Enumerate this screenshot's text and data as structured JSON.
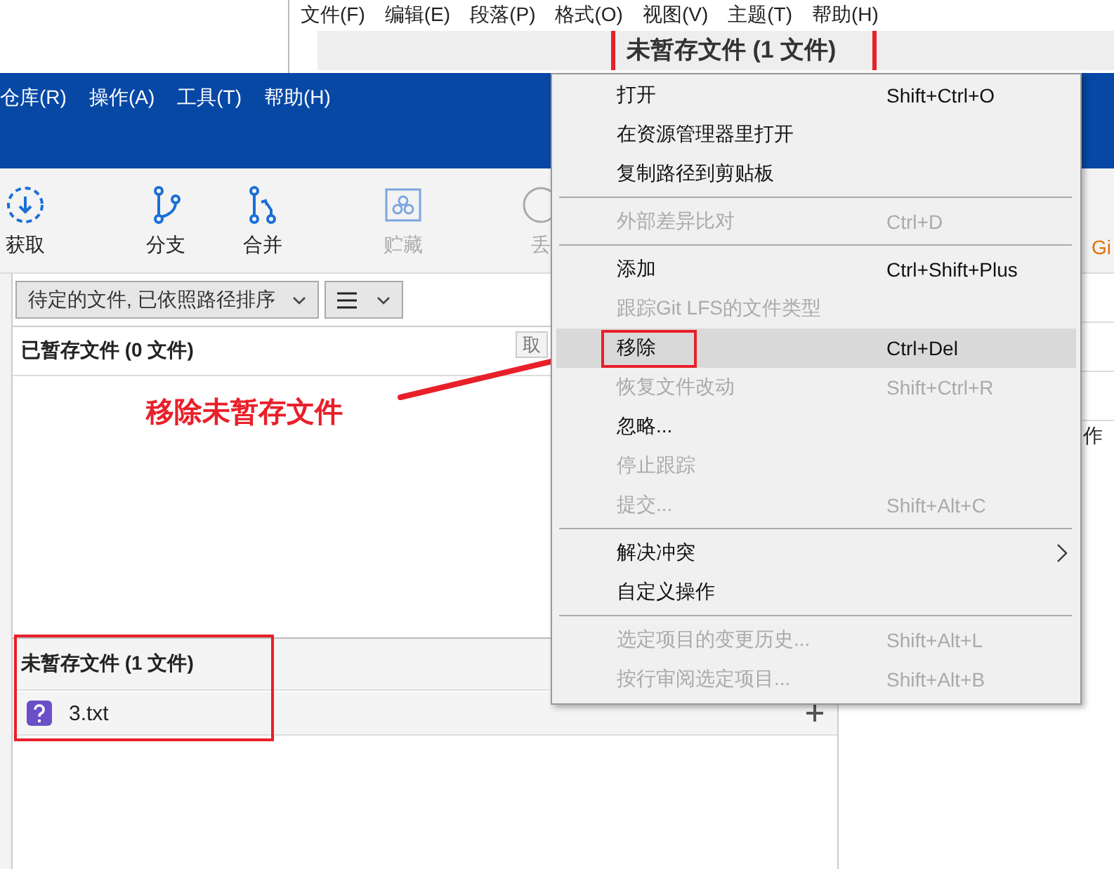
{
  "back_window": {
    "menu": [
      "文件(F)",
      "编辑(E)",
      "段落(P)",
      "格式(O)",
      "视图(V)",
      "主题(T)",
      "帮助(H)"
    ],
    "banner_title": "未暂存文件 (1 文件)"
  },
  "main_window": {
    "menu": [
      "仓库(R)",
      "操作(A)",
      "工具(T)",
      "帮助(H)"
    ],
    "toolbar": [
      {
        "label": "获取",
        "kind": "fetch",
        "disabled": false
      },
      {
        "label": "分支",
        "kind": "branch",
        "disabled": false
      },
      {
        "label": "合并",
        "kind": "merge",
        "disabled": false
      },
      {
        "label": "贮藏",
        "kind": "stash",
        "disabled": true
      },
      {
        "label": "丢",
        "kind": "discard",
        "disabled": true
      }
    ],
    "filter_dropdown": "待定的文件, 已依照路径排序",
    "staged": {
      "title": "已暂存文件 (0 文件)",
      "button": "取"
    },
    "unstaged": {
      "title": "未暂存文件 (1 文件)",
      "files": [
        {
          "name": "3.txt",
          "kind": "untracked"
        }
      ]
    },
    "right_pane": {
      "toolbar_label": "Gi",
      "row_text": "作"
    }
  },
  "context_menu": [
    {
      "kind": "item",
      "label": "打开",
      "shortcut": "Shift+Ctrl+O",
      "disabled": false,
      "selected": false,
      "submenu": false
    },
    {
      "kind": "item",
      "label": "在资源管理器里打开",
      "disabled": false,
      "selected": false,
      "submenu": false
    },
    {
      "kind": "item",
      "label": "复制路径到剪贴板",
      "disabled": false,
      "selected": false,
      "submenu": false
    },
    {
      "kind": "separator"
    },
    {
      "kind": "item",
      "label": "外部差异比对",
      "shortcut": "Ctrl+D",
      "disabled": true,
      "selected": false,
      "submenu": false
    },
    {
      "kind": "separator"
    },
    {
      "kind": "item",
      "label": "添加",
      "shortcut": "Ctrl+Shift+Plus",
      "disabled": false,
      "selected": false,
      "submenu": false
    },
    {
      "kind": "item",
      "label": "跟踪Git LFS的文件类型",
      "disabled": true,
      "selected": false,
      "submenu": false
    },
    {
      "kind": "item",
      "label": "移除",
      "shortcut": "Ctrl+Del",
      "disabled": false,
      "selected": true,
      "submenu": false
    },
    {
      "kind": "item",
      "label": "恢复文件改动",
      "shortcut": "Shift+Ctrl+R",
      "disabled": true,
      "selected": false,
      "submenu": false
    },
    {
      "kind": "item",
      "label": "忽略...",
      "disabled": false,
      "selected": false,
      "submenu": false
    },
    {
      "kind": "item",
      "label": "停止跟踪",
      "disabled": true,
      "selected": false,
      "submenu": false
    },
    {
      "kind": "item",
      "label": "提交...",
      "shortcut": "Shift+Alt+C",
      "disabled": true,
      "selected": false,
      "submenu": false
    },
    {
      "kind": "separator"
    },
    {
      "kind": "item",
      "label": "解决冲突",
      "disabled": false,
      "selected": false,
      "submenu": true
    },
    {
      "kind": "item",
      "label": "自定义操作",
      "disabled": false,
      "selected": false,
      "submenu": false
    },
    {
      "kind": "separator"
    },
    {
      "kind": "item",
      "label": "选定项目的变更历史...",
      "shortcut": "Shift+Alt+L",
      "disabled": true,
      "selected": false,
      "submenu": false
    },
    {
      "kind": "item",
      "label": "按行审阅选定项目...",
      "shortcut": "Shift+Alt+B",
      "disabled": true,
      "selected": false,
      "submenu": false
    }
  ],
  "annotation": {
    "text": "移除未暂存文件"
  }
}
